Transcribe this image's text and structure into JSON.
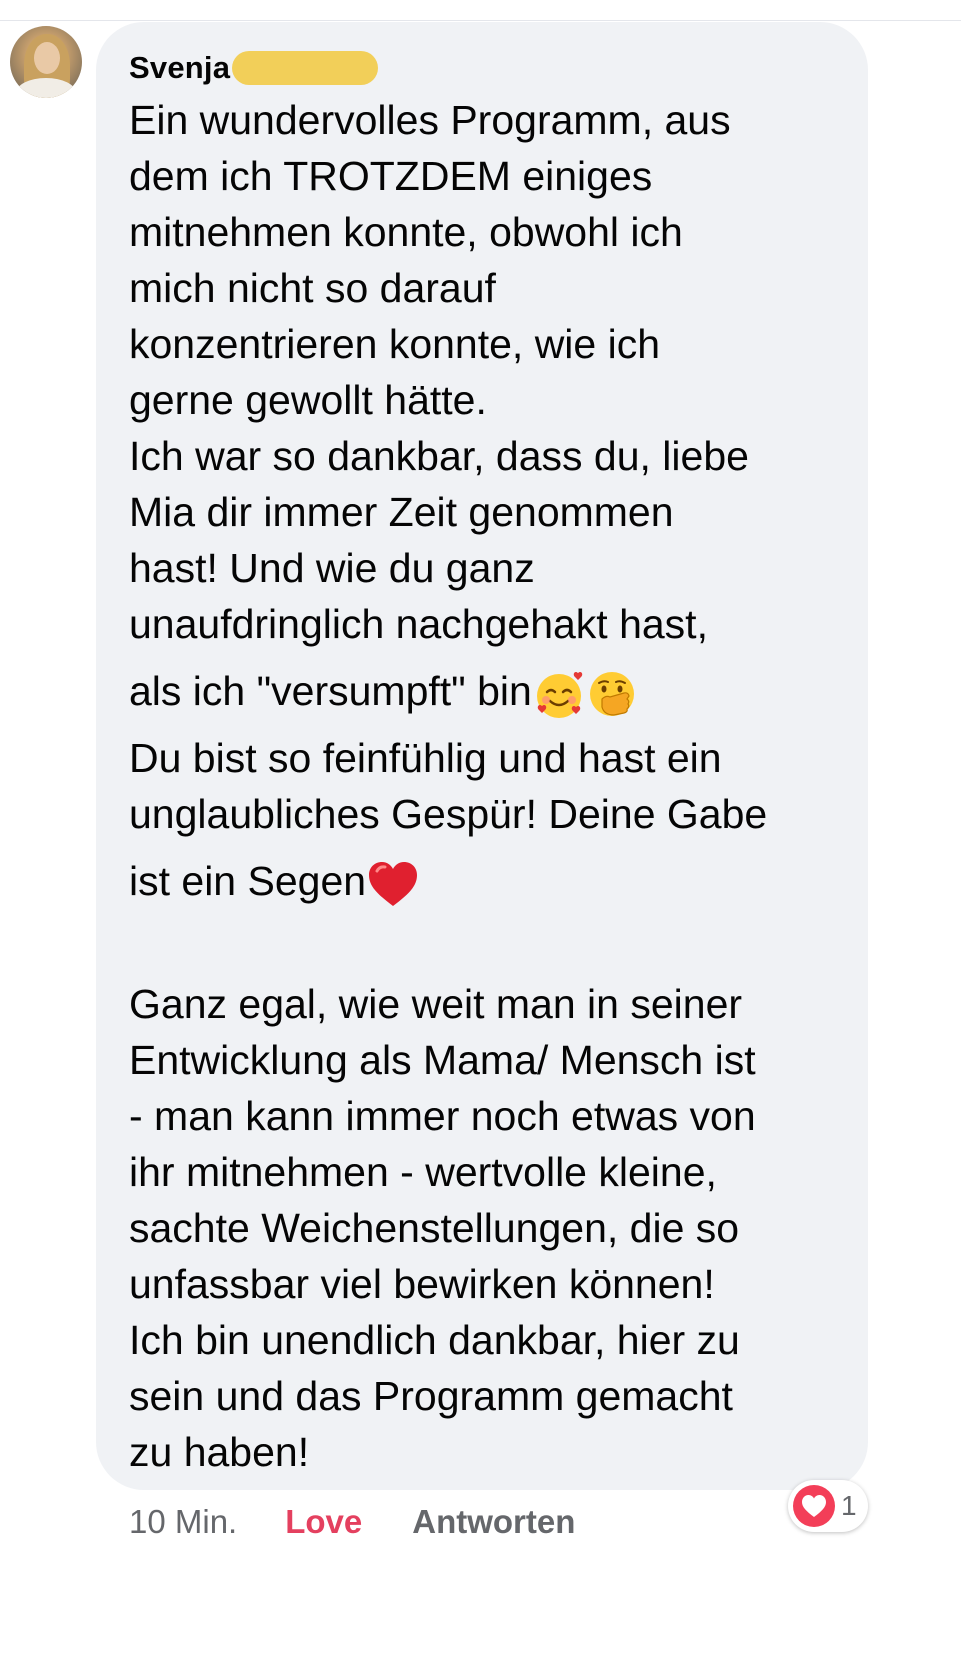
{
  "comment": {
    "author": "Svenja",
    "lines": [
      "Ein wundervolles Programm, aus",
      "dem ich TROTZDEM einiges",
      "mitnehmen konnte, obwohl ich",
      "mich nicht so darauf",
      "konzentrieren konnte, wie ich",
      "gerne gewollt hätte.",
      "Ich war so dankbar, dass du, liebe",
      "Mia dir immer Zeit genommen",
      "hast! Und wie du ganz",
      "unaufdringlich nachgehakt hast,",
      "als ich \"versumpft\" bin",
      "Du bist so feinfühlig und hast ein",
      "unglaubliches Gespür! Deine Gabe",
      "ist ein Segen",
      "Ganz egal, wie weit man in seiner",
      "Entwicklung als Mama/ Mensch ist",
      "- man kann immer noch etwas von",
      "ihr mitnehmen - wertvolle kleine,",
      "sachte Weichenstellungen, die so",
      "unfassbar viel bewirken können!",
      "Ich bin unendlich dankbar, hier zu",
      "sein und das Programm gemacht",
      "zu haben!"
    ],
    "emojis": {
      "hearts_face": "smiling-face-with-hearts-icon",
      "hand_over_mouth": "face-with-hand-over-mouth-icon",
      "red_heart": "red-heart-icon"
    }
  },
  "actions": {
    "time": "10 Min.",
    "love": "Love",
    "reply": "Antworten"
  },
  "reactions": {
    "icon": "heart-reaction-icon",
    "count": "1"
  },
  "colors": {
    "bubble": "#f0f2f5",
    "love_accent": "#e4405f",
    "secondary_text": "#65676b",
    "redaction": "#f2cc4b"
  }
}
